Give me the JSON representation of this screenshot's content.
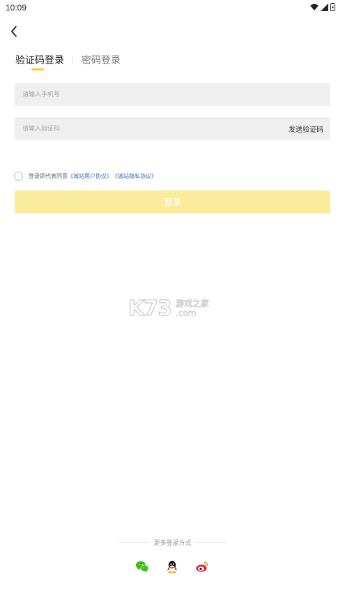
{
  "status_bar": {
    "time": "10:09"
  },
  "tabs": [
    {
      "label": "验证码登录",
      "active": true
    },
    {
      "label": "密码登录",
      "active": false
    }
  ],
  "phone_field": {
    "placeholder": "请输入手机号",
    "value": ""
  },
  "code_field": {
    "placeholder": "请输入验证码",
    "value": "",
    "send_label": "发送验证码"
  },
  "agreement": {
    "prefix": "登录即代表同意",
    "user_agreement": "《城站用户协议》",
    "privacy_agreement": "《城站隐私协议》"
  },
  "login_button": {
    "label": "登录"
  },
  "watermark": {
    "main": "K73",
    "cn": "游戏之家",
    "sub": ".com"
  },
  "more_login": {
    "label": "更多登录方式"
  },
  "social_icons": [
    "wechat-icon",
    "qq-icon",
    "weibo-icon"
  ],
  "colors": {
    "accent": "#f5cd23",
    "login_button_bg": "#fbeb9c",
    "link": "#3b6fb6",
    "field_bg": "#efefef"
  }
}
